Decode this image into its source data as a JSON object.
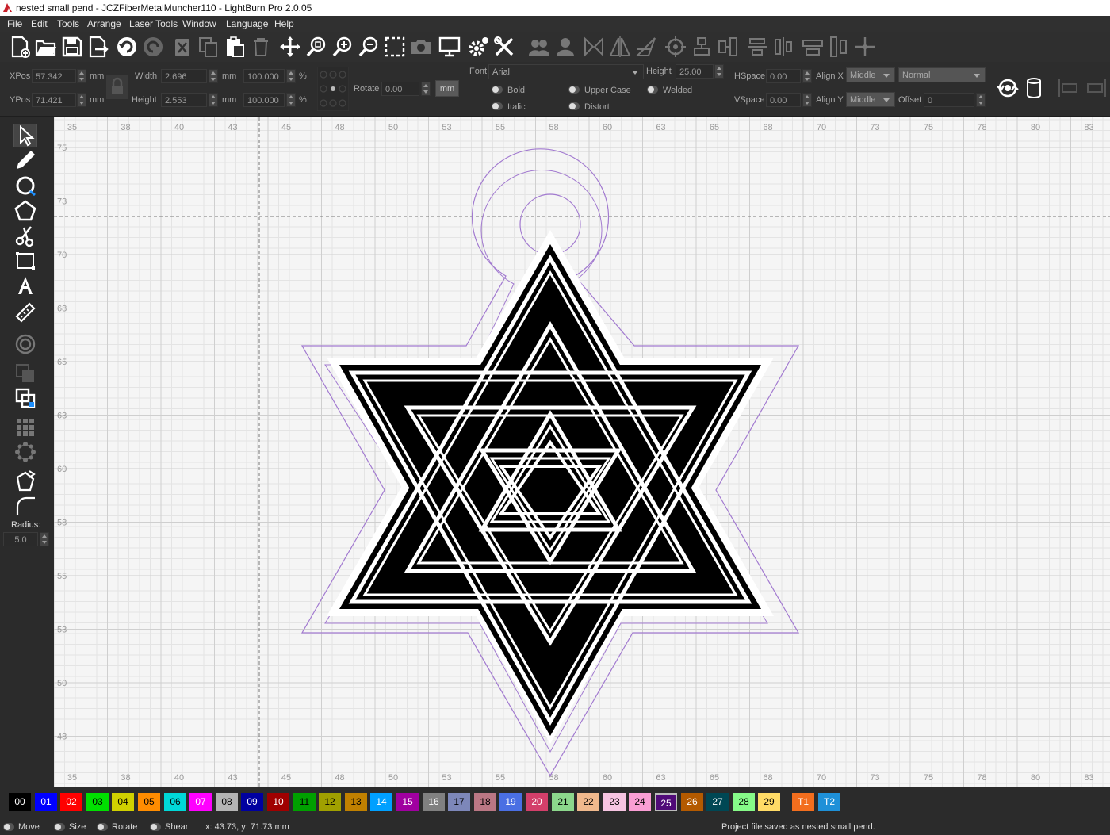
{
  "window": {
    "title": "nested small pend - JCZFiberMetalMuncher110 - LightBurn Pro 2.0.05"
  },
  "menu": [
    "File",
    "Edit",
    "Tools",
    "Arrange",
    "Laser Tools",
    "Window",
    "Language",
    "Help"
  ],
  "properties": {
    "xpos_label": "XPos",
    "xpos": "57.342",
    "ypos_label": "YPos",
    "ypos": "71.421",
    "unit": "mm",
    "width_label": "Width",
    "width": "2.696",
    "height_label": "Height",
    "height": "2.553",
    "scale_w": "100.000",
    "scale_h": "100.000",
    "percent": "%",
    "rotate_label": "Rotate",
    "rotate": "0.00",
    "unit_button": "mm",
    "font_label": "Font",
    "font_value": "Arial",
    "text_height_label": "Height",
    "text_height": "25.00",
    "bold": "Bold",
    "italic": "Italic",
    "upper_case": "Upper Case",
    "distort": "Distort",
    "welded": "Welded",
    "hspace_label": "HSpace",
    "hspace": "0.00",
    "vspace_label": "VSpace",
    "vspace": "0.00",
    "alignx_label": "Align X",
    "alignx": "Middle",
    "aligny_label": "Align Y",
    "aligny": "Middle",
    "mode": "Normal",
    "offset_label": "Offset",
    "offset": "0"
  },
  "sidebar": {
    "radius_label": "Radius:",
    "radius": "5.0"
  },
  "ruler": {
    "x": [
      "35",
      "38",
      "40",
      "43",
      "45",
      "48",
      "50",
      "53",
      "55",
      "58",
      "60",
      "63",
      "65",
      "68",
      "70",
      "73",
      "75",
      "78",
      "80",
      "83"
    ],
    "y": [
      "75",
      "73",
      "70",
      "68",
      "65",
      "63",
      "60",
      "58",
      "55",
      "53",
      "50",
      "48"
    ]
  },
  "palette": [
    {
      "label": "00",
      "color": "#000000",
      "text": "#ffffff"
    },
    {
      "label": "01",
      "color": "#0000ff",
      "text": "#ffffff"
    },
    {
      "label": "02",
      "color": "#ff0000",
      "text": "#ffffff"
    },
    {
      "label": "03",
      "color": "#00e000",
      "text": "#000000"
    },
    {
      "label": "04",
      "color": "#d0d000",
      "text": "#000000"
    },
    {
      "label": "05",
      "color": "#ff8c00",
      "text": "#000000"
    },
    {
      "label": "06",
      "color": "#00d8d8",
      "text": "#000000"
    },
    {
      "label": "07",
      "color": "#ff00ff",
      "text": "#ffffff"
    },
    {
      "label": "08",
      "color": "#b4b4b4",
      "text": "#000000"
    },
    {
      "label": "09",
      "color": "#0000a0",
      "text": "#ffffff"
    },
    {
      "label": "10",
      "color": "#a00000",
      "text": "#ffffff"
    },
    {
      "label": "11",
      "color": "#00a000",
      "text": "#000000"
    },
    {
      "label": "12",
      "color": "#a0a000",
      "text": "#000000"
    },
    {
      "label": "13",
      "color": "#c08000",
      "text": "#000000"
    },
    {
      "label": "14",
      "color": "#00a0ff",
      "text": "#ffffff"
    },
    {
      "label": "15",
      "color": "#a000a0",
      "text": "#ffffff"
    },
    {
      "label": "16",
      "color": "#808080",
      "text": "#ffffff"
    },
    {
      "label": "17",
      "color": "#7d87b9",
      "text": "#000000"
    },
    {
      "label": "18",
      "color": "#bb7784",
      "text": "#000000"
    },
    {
      "label": "19",
      "color": "#4a6fe3",
      "text": "#ffffff"
    },
    {
      "label": "20",
      "color": "#d33f6a",
      "text": "#ffffff"
    },
    {
      "label": "21",
      "color": "#8cd78c",
      "text": "#000000"
    },
    {
      "label": "22",
      "color": "#f0b98d",
      "text": "#000000"
    },
    {
      "label": "23",
      "color": "#f6c4e1",
      "text": "#000000"
    },
    {
      "label": "24",
      "color": "#fa9ed4",
      "text": "#000000"
    },
    {
      "label": "25",
      "color": "#500a78",
      "text": "#ffffff"
    },
    {
      "label": "26",
      "color": "#b45a00",
      "text": "#ffffff"
    },
    {
      "label": "27",
      "color": "#004754",
      "text": "#ffffff"
    },
    {
      "label": "28",
      "color": "#86fa88",
      "text": "#000000"
    },
    {
      "label": "29",
      "color": "#ffdb66",
      "text": "#000000"
    },
    {
      "label": "T1",
      "color": "#f36e1e",
      "text": "#ffffff"
    },
    {
      "label": "T2",
      "color": "#1e90d8",
      "text": "#ffffff"
    }
  ],
  "status": {
    "move": "Move",
    "size": "Size",
    "rotate": "Rotate",
    "shear": "Shear",
    "coords": "x: 43.73, y: 71.73 mm",
    "message": "Project file saved as nested small pend."
  }
}
